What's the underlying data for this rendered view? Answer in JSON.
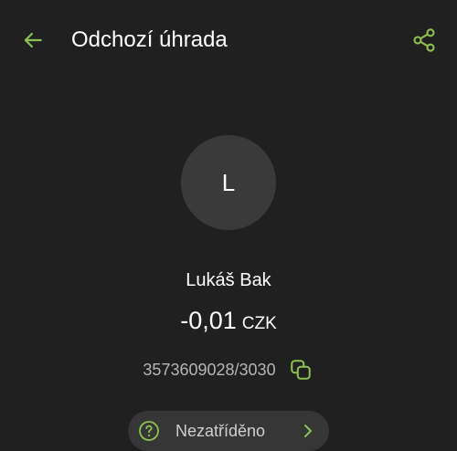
{
  "header": {
    "title": "Odchozí úhrada",
    "back_icon": "arrow-left-icon",
    "share_icon": "share-icon"
  },
  "counterparty": {
    "avatar_initial": "L",
    "name": "Lukáš Bak"
  },
  "amount": {
    "value": "-0,01",
    "currency": "CZK"
  },
  "account": {
    "number": "3573609028/3030",
    "copy_icon": "copy-icon"
  },
  "category": {
    "label": "Nezatříděno",
    "icon": "question-circle-icon",
    "chevron_icon": "chevron-right-icon"
  },
  "colors": {
    "background": "#202020",
    "accent": "#8cc152",
    "avatar_bg": "#3a3a3a",
    "chip_bg": "#363636",
    "secondary_text": "#b5b5b5"
  }
}
